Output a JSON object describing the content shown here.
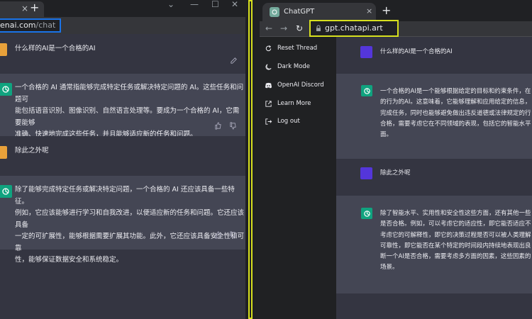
{
  "left_window": {
    "tab_close": "×",
    "new_tab": "+",
    "window_controls": [
      "⌄",
      "—",
      "☐",
      "✕"
    ],
    "url": {
      "host_fragment": "enai.com",
      "path": "/chat"
    },
    "messages": [
      {
        "role": "user",
        "text": "什么样的AI是一个合格的AI"
      },
      {
        "role": "assistant",
        "lines": [
          "一个合格的 AI 通常指能够完成特定任务或解决特定问题的 AI。这些任务和问题可",
          "能包括语音识别、图像识别、自然语言处理等。要成为一个合格的 AI，它需要能够",
          "准确、快速地完成这些任务，并且能够适应新的任务和问题。"
        ]
      },
      {
        "role": "user",
        "text": "除此之外呢"
      },
      {
        "role": "assistant",
        "lines": [
          "除了能够完成特定任务或解决特定问题，一个合格的 AI 还应该具备一些特征。",
          "例如，它应该能够进行学习和自我改进，以便适应新的任务和问题。它还应该具备",
          "一定的可扩展性，能够根据需要扩展其功能。此外，它还应该具备安全性和可靠",
          "性，能够保证数据安全和系统稳定。"
        ]
      }
    ]
  },
  "right_window": {
    "tab_title": "ChatGPT",
    "tab_close": "×",
    "new_tab": "+",
    "nav": {
      "back": "←",
      "forward": "→",
      "reload": "↻"
    },
    "url": "gpt.chatapi.art",
    "sidebar": [
      {
        "label": "Reset Thread",
        "icon": "reset-icon"
      },
      {
        "label": "Dark Mode",
        "icon": "moon-icon"
      },
      {
        "label": "OpenAI Discord",
        "icon": "discord-icon"
      },
      {
        "label": "Learn More",
        "icon": "external-link-icon"
      },
      {
        "label": "Log out",
        "icon": "logout-icon"
      }
    ],
    "messages": [
      {
        "role": "user",
        "text": "什么样的AI是一个合格的AI"
      },
      {
        "role": "assistant",
        "lines": [
          "一个合格的AI是一个能够根据给定的目标和约束条件，在",
          "的行为的AI。这意味着，它能够理解和应用给定的信息，",
          "完成任务，同时也能够避免做出违反道德或法律规定的行",
          "合格，需要考虑它在不同领域的表现，包括它的智能水平",
          "面。"
        ]
      },
      {
        "role": "user",
        "text": "除此之外呢"
      },
      {
        "role": "assistant",
        "lines": [
          "除了智能水平、实用性和安全性这些方面，还有其他一些",
          "是否合格。例如，可以考虑它的适应性，即它能否适应不",
          "考虑它的可解释性，即它的决策过程是否可以被人类理解",
          "可靠性，即它能否在某个特定的时间段内持续地表现出良",
          "断一个AI是否合格，需要考虑多方面的因素，这些因素的",
          "场景。"
        ]
      }
    ]
  },
  "colors": {
    "user_avatar_left": "#e8a13a",
    "user_avatar_right": "#5436da",
    "assistant_avatar": "#10a37f",
    "focus_outline_left": "#1a73e8",
    "focus_outline_right": "#d7e01e"
  }
}
